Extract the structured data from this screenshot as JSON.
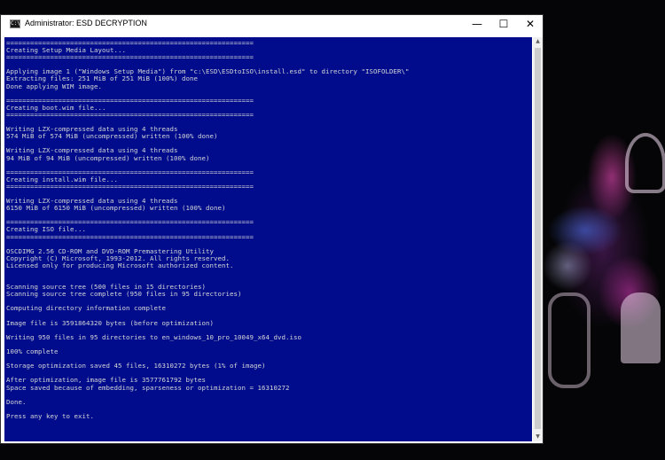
{
  "window": {
    "title": "Administrator:  ESD DECRYPTION",
    "icon_name": "console-icon",
    "controls": {
      "minimize": "—",
      "maximize": "☐",
      "close": "✕"
    }
  },
  "console": {
    "background": "#000c8c",
    "text_color": "#d6d6d6",
    "lines": [
      "==============================================================",
      "Creating Setup Media Layout...",
      "==============================================================",
      "",
      "Applying image 1 (\"Windows Setup Media\") from \"c:\\ESD\\ESDtoISO\\install.esd\" to directory \"ISOFOLDER\\\"",
      "Extracting files: 251 MiB of 251 MiB (100%) done",
      "Done applying WIM image.",
      "",
      "==============================================================",
      "Creating boot.wim file...",
      "==============================================================",
      "",
      "Writing LZX-compressed data using 4 threads",
      "574 MiB of 574 MiB (uncompressed) written (100% done)",
      "",
      "Writing LZX-compressed data using 4 threads",
      "94 MiB of 94 MiB (uncompressed) written (100% done)",
      "",
      "==============================================================",
      "Creating install.wim file...",
      "==============================================================",
      "",
      "Writing LZX-compressed data using 4 threads",
      "6150 MiB of 6150 MiB (uncompressed) written (100% done)",
      "",
      "==============================================================",
      "Creating ISO file...",
      "==============================================================",
      "",
      "OSCDIMG 2.56 CD-ROM and DVD-ROM Premastering Utility",
      "Copyright (C) Microsoft, 1993-2012. All rights reserved.",
      "Licensed only for producing Microsoft authorized content.",
      "",
      "",
      "Scanning source tree (500 files in 15 directories)",
      "Scanning source tree complete (950 files in 95 directories)",
      "",
      "Computing directory information complete",
      "",
      "Image file is 3591864320 bytes (before optimization)",
      "",
      "Writing 950 files in 95 directories to en_windows_10_pro_10049_x64_dvd.iso",
      "",
      "100% complete",
      "",
      "Storage optimization saved 45 files, 16310272 bytes (1% of image)",
      "",
      "After optimization, image file is 3577761792 bytes",
      "Space saved because of embedding, sparseness or optimization = 16310272",
      "",
      "Done.",
      "",
      "Press any key to exit."
    ]
  },
  "scrollbar": {
    "up_arrow": "▲",
    "down_arrow": "▼"
  }
}
